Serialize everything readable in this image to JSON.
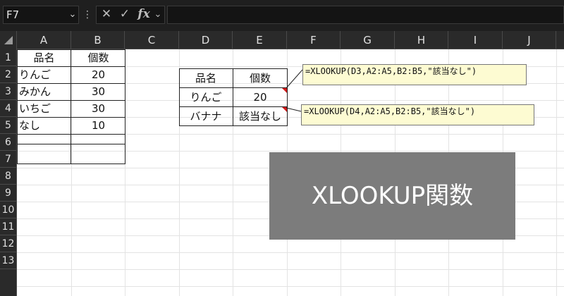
{
  "namebox": {
    "value": "F7",
    "arrow": "⌄"
  },
  "formula_bar": {
    "cancel_glyph": "✕",
    "confirm_glyph": "✓",
    "fx_glyph": "fx",
    "more_glyph": "⋮",
    "expand_glyph": "⌄",
    "value": ""
  },
  "columns": [
    "A",
    "B",
    "C",
    "D",
    "E",
    "F",
    "G",
    "H",
    "I",
    "J"
  ],
  "rows": [
    "1",
    "2",
    "3",
    "4",
    "5",
    "6",
    "7",
    "8",
    "9",
    "10",
    "11",
    "12",
    "13"
  ],
  "table1": {
    "header": [
      "品名",
      "個数"
    ],
    "rows": [
      [
        "りんご",
        "20"
      ],
      [
        "みかん",
        "30"
      ],
      [
        "いちご",
        "30"
      ],
      [
        "なし",
        "10"
      ]
    ]
  },
  "table2": {
    "header": [
      "品名",
      "個数"
    ],
    "rows": [
      [
        "りんご",
        "20"
      ],
      [
        "バナナ",
        "該当なし"
      ]
    ]
  },
  "comments": [
    "=XLOOKUP(D3,A2:A5,B2:B5,\"該当なし\")",
    "=XLOOKUP(D4,A2:A5,B2:B5,\"該当なし\")"
  ],
  "overlay": {
    "title": "XLOOKUP関数",
    "background": "#7c7c7c"
  },
  "colors": {
    "chrome": "#1f1f1f",
    "comment_bg": "#fdfbd2",
    "comment_marker": "#d11a1a"
  }
}
